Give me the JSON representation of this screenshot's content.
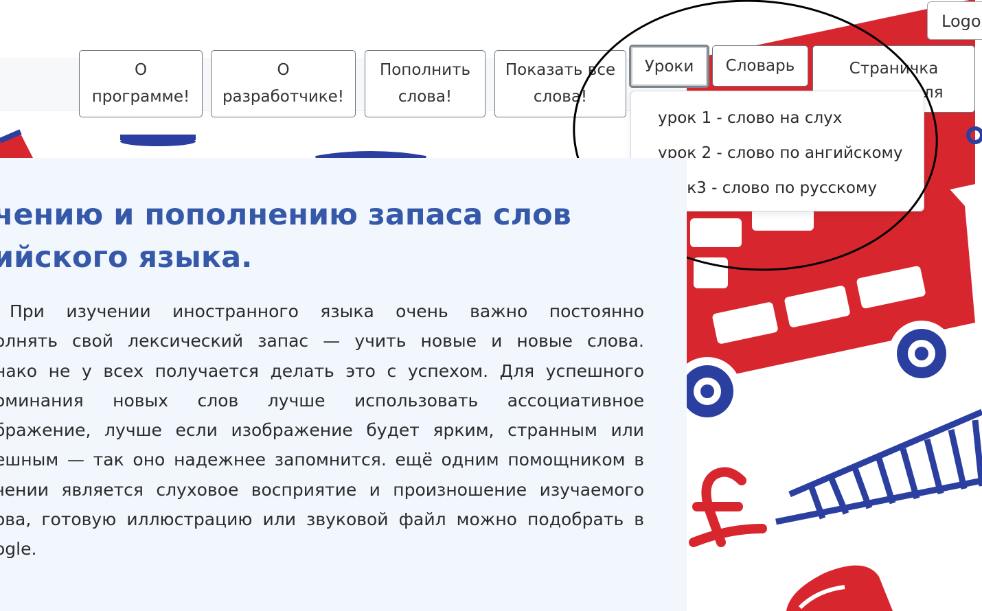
{
  "header": {
    "logout_label": "Logo",
    "nav": [
      {
        "label": "О программе!"
      },
      {
        "label": "О разработчике!"
      },
      {
        "label": "Пополнить слова!"
      },
      {
        "label": "Показать все слова!"
      },
      {
        "label": "Уроки"
      },
      {
        "label": "Словарь"
      },
      {
        "label": "Страничка"
      }
    ],
    "nav_extra_text": "ля"
  },
  "lessons_dropdown": {
    "items": [
      {
        "label": "урок 1 - слово на слух"
      },
      {
        "label": "урок 2 - слово по ангийскому"
      },
      {
        "label": "урок3 - слово по русскому"
      }
    ]
  },
  "main": {
    "heading_lines": [
      "чению и пополнению запаса слов",
      "ийского языка."
    ],
    "paragraph_lines": [
      " При изучении иностранного языка очень важно постоянно",
      "олнять свой лексический запас — учить новые и новые слова.",
      "нако не у всех получается делать это с успехом. Для успешного",
      "оминания новых слов лучше использовать ассоциативное",
      "бражение, лучше если изображение будет ярким, странным или",
      "ешным — так оно надежнее запомнится.  ещё одним помощником в",
      "чении является слуховое восприятие и произношение изучаемого",
      "ова, готовую иллюстрацию или звуковой файл можно подобрать в",
      "ogle."
    ]
  },
  "colors": {
    "heading": "#3559a8",
    "bus_red": "#d8262e",
    "deco_blue": "#2b3fa0",
    "content_bg": "#f2f7fe"
  }
}
